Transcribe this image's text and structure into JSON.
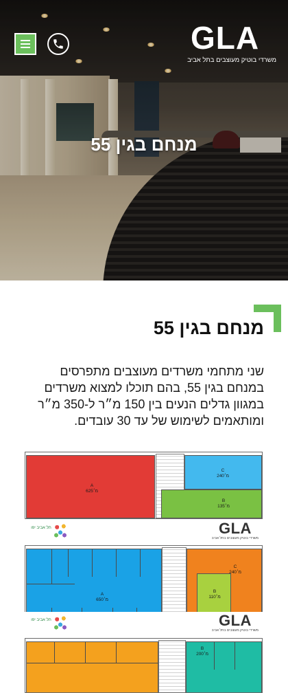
{
  "header": {
    "logo": {
      "mark": "GLA",
      "tagline": "משרדי בוטיק מעוצבים בתל אביב"
    },
    "menu_icon": "hamburger-icon",
    "phone_icon": "phone-icon",
    "colors": {
      "accent": "#6bbf5c",
      "text": "#111111",
      "hero_text": "#ffffff"
    }
  },
  "hero": {
    "title": "מנחם בגין 55"
  },
  "section": {
    "title": "מנחם בגין 55",
    "body": "שני מתחמי משרדים מעוצבים מתפרסים במנחם בגין 55, בהם תוכלו למצוא משרדים במגוון גדלים הנעים בין 150 מ״ר ל-350 מ״ר ומותאמים לשימוש של עד 30 עובדים."
  },
  "floor_plans": [
    {
      "rooms": [
        {
          "id": "A",
          "area": "625מ׳",
          "color": "#e23b36"
        },
        {
          "id": "C",
          "area": "240מ׳",
          "color": "#43b9ee"
        },
        {
          "id": "B",
          "area": "135מ׳",
          "color": "#7ac143"
        }
      ]
    },
    {
      "rooms": [
        {
          "id": "A",
          "area": "650מ׳",
          "color": "#1aa2e6"
        },
        {
          "id": "C",
          "area": "240מ׳",
          "color": "#f0821e"
        },
        {
          "id": "B",
          "area": "110מ׳",
          "color": "#a8d13f"
        }
      ]
    },
    {
      "rooms": [
        {
          "id": "B",
          "area": "200מ׳",
          "color": "#1fbca4"
        }
      ]
    }
  ],
  "plan_banner": {
    "logo_mark": "GLA",
    "logo_tagline": "משרדי בוטיק מעוצבים בתל אביב",
    "seal_text": "תל אביב יפו"
  }
}
